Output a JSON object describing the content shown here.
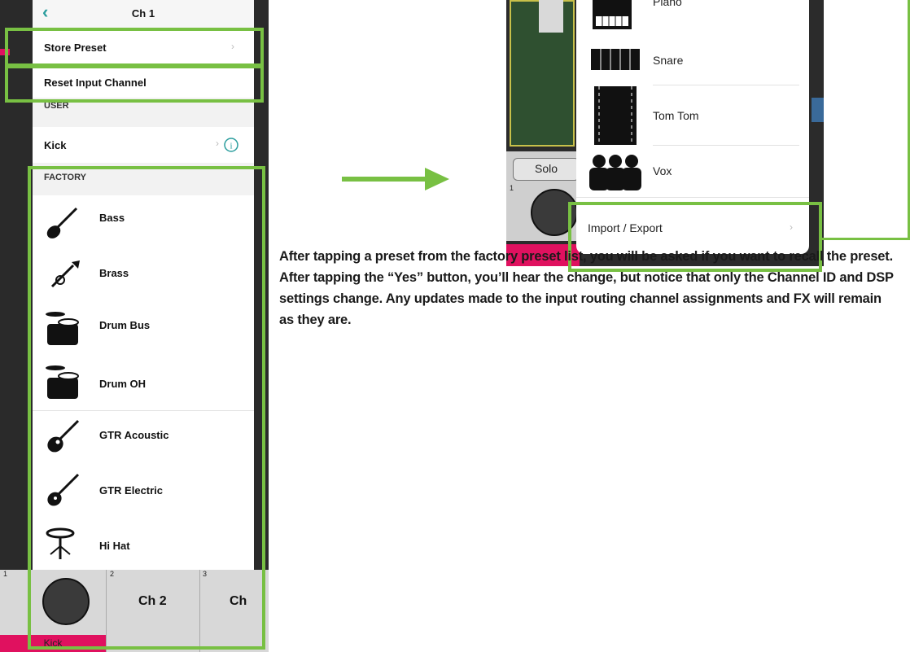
{
  "left_panel": {
    "header_title": "Ch 1",
    "store_preset": "Store Preset",
    "reset_input_channel": "Reset Input Channel",
    "user_section": "USER",
    "user_items": [
      "Kick"
    ],
    "factory_section": "FACTORY",
    "factory_items": [
      "Bass",
      "Brass",
      "Drum Bus",
      "Drum OH",
      "GTR Acoustic",
      "GTR Electric",
      "Hi Hat"
    ],
    "channel_numbers": [
      "1",
      "2",
      "3"
    ],
    "channel_labels": [
      "Ch 2",
      "Ch"
    ],
    "kick_label": "Kick"
  },
  "right_panel": {
    "partial_item": "Piano",
    "items": [
      "Snare",
      "Tom Tom",
      "Vox"
    ],
    "import_export": "Import / Export",
    "solo_label": "Solo",
    "channel_number": "1"
  },
  "body_text": "After tapping a preset from the factory preset list, you will be asked if you want to recall the preset. After tapping the “Yes” button, you’ll hear the change, but notice that only the Channel ID and DSP settings change. Any updates made to the input routing channel assignments and FX will remain as they are.",
  "colors": {
    "highlight": "#78c043",
    "accent_pink": "#e0115f",
    "teal": "#2a9d9d"
  }
}
